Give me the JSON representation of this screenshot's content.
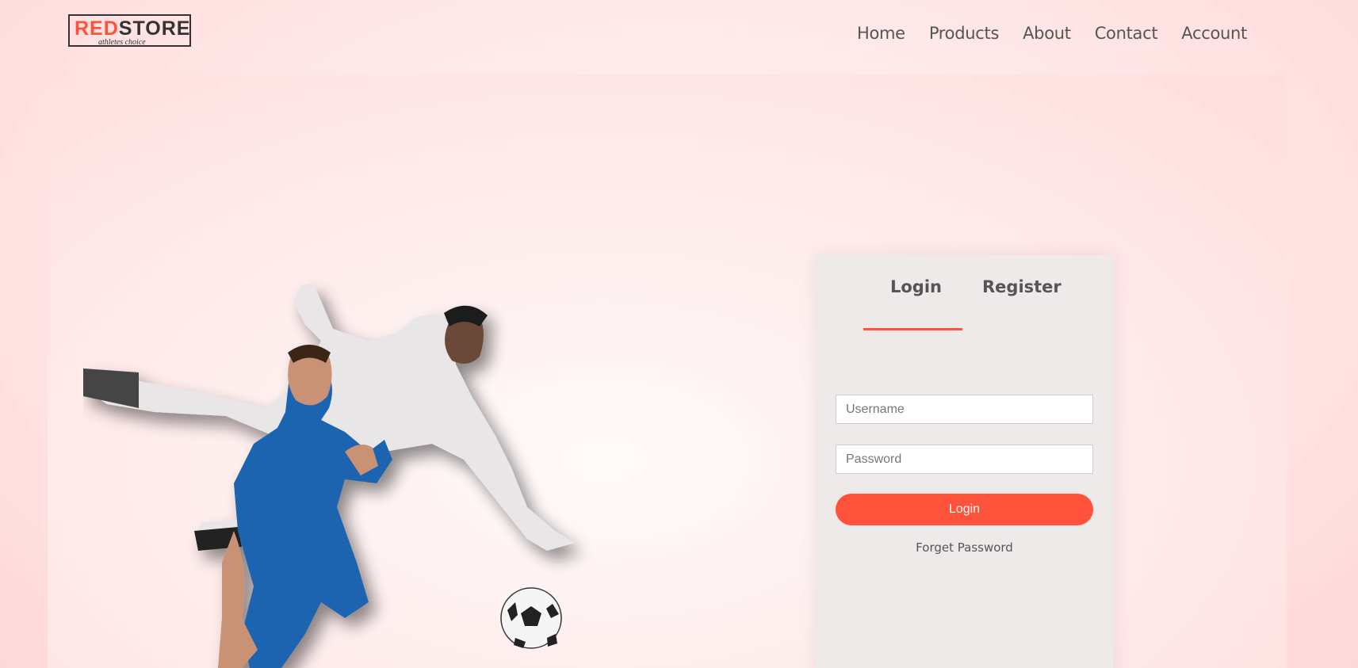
{
  "logo": {
    "brand_red": "RED",
    "brand_dark": "STORE",
    "tagline": "athletes choice"
  },
  "nav": {
    "items": [
      {
        "label": "Home"
      },
      {
        "label": "Products"
      },
      {
        "label": "About"
      },
      {
        "label": "Contact"
      },
      {
        "label": "Account"
      }
    ]
  },
  "form": {
    "tabs": {
      "login": "Login",
      "register": "Register"
    },
    "username_placeholder": "Username",
    "password_placeholder": "Password",
    "submit_label": "Login",
    "forgot_label": "Forget Password"
  },
  "colors": {
    "accent": "#ff523b",
    "card_bg": "#efeaea"
  },
  "hero_image": {
    "icon": "football-players-illustration"
  }
}
